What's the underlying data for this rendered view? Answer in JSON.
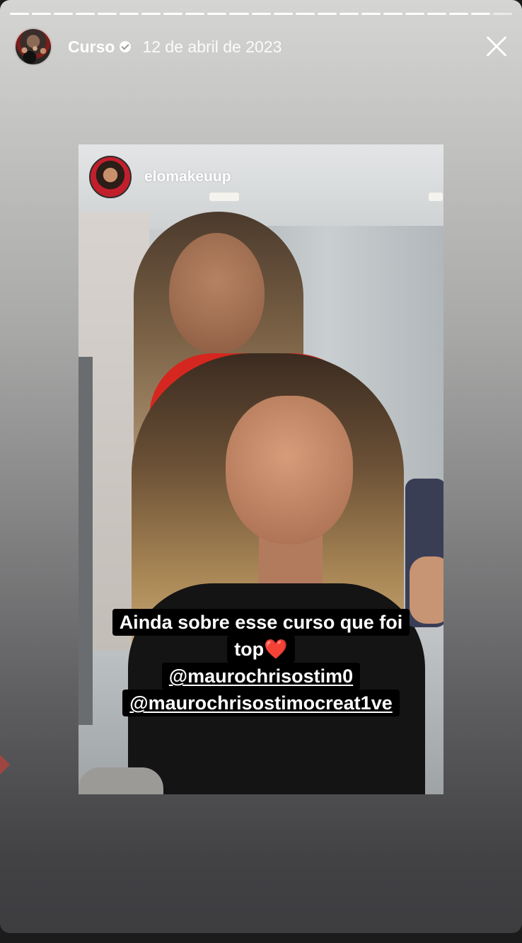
{
  "story": {
    "progress_segments": 23,
    "progress_done": 22,
    "account_name": "Curso",
    "date": "12 de abril de 2023",
    "icons": {
      "verified": "verified-badge-icon",
      "close": "close-icon"
    }
  },
  "post": {
    "username": "elomakeuup",
    "caption": {
      "line1": "Ainda sobre esse curso que foi",
      "line2": "top",
      "heart": "❤️",
      "mention1": "@maurochrisostim0",
      "mention2": "@maurochrisostimocreat1ve"
    }
  },
  "colors": {
    "page_bg": "#1b1b1c",
    "caption_bg": "#000000",
    "heart": "#e0241b"
  }
}
